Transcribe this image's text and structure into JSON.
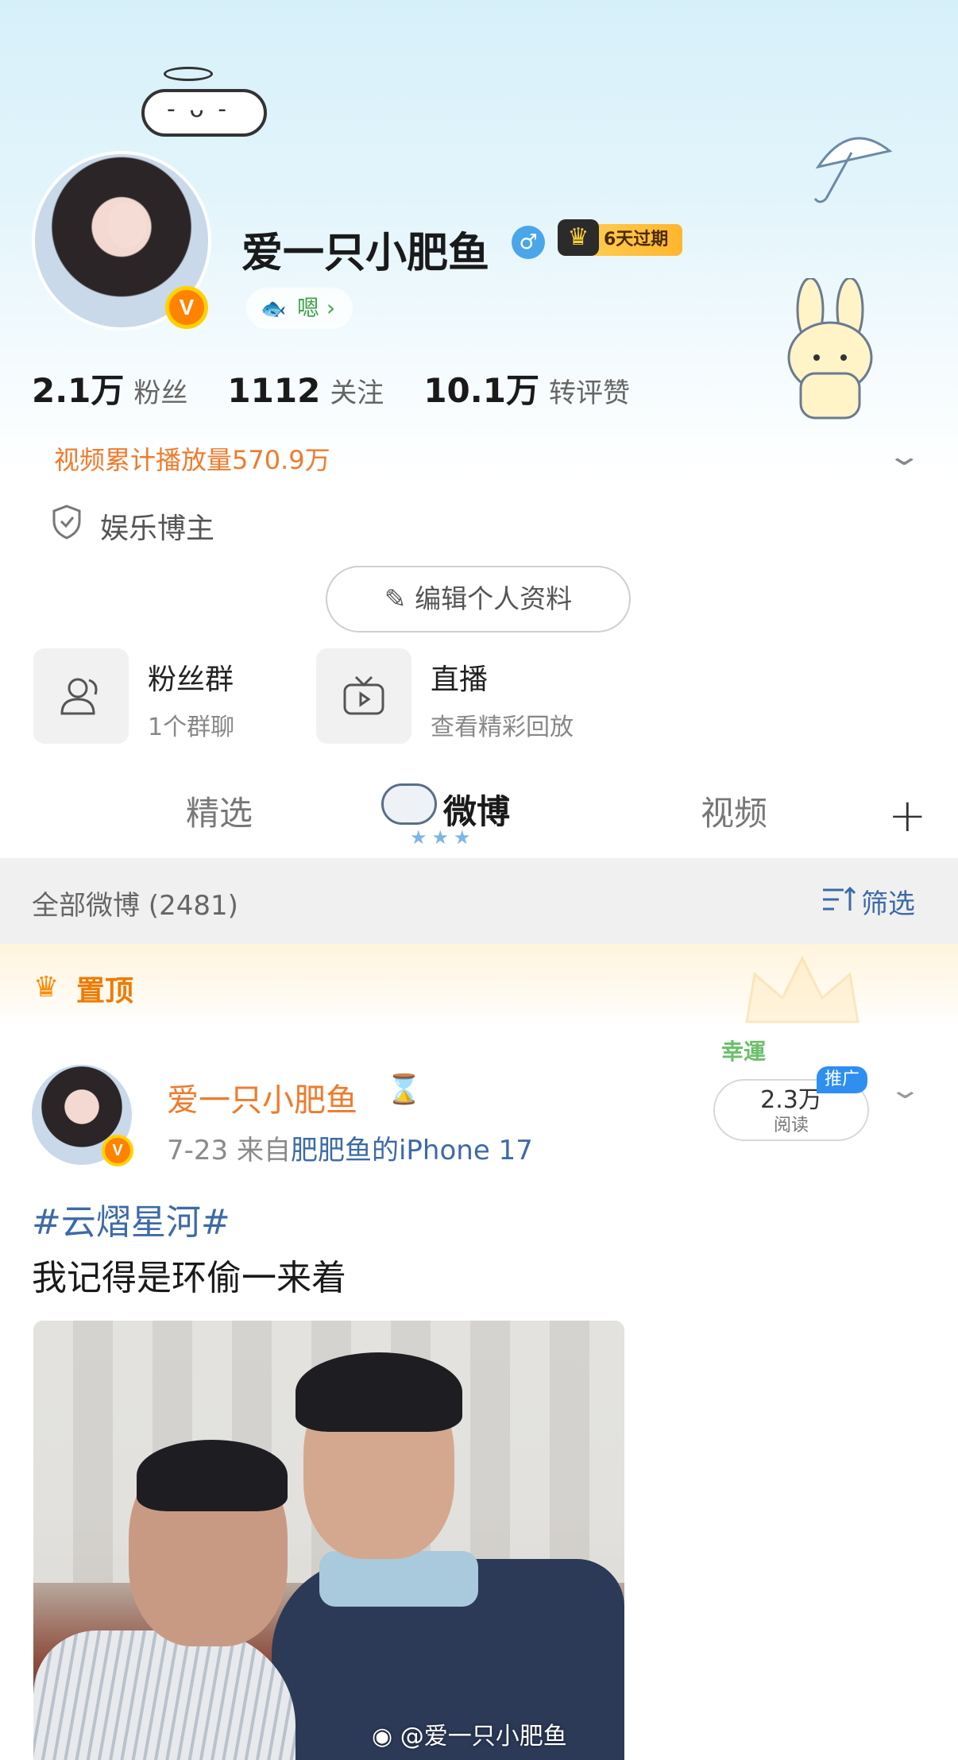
{
  "profile": {
    "name": "爱一只小肥鱼",
    "vip_badge": "6天过期",
    "status_text": "嗯",
    "stats": [
      {
        "value": "2.1万",
        "label": "粉丝"
      },
      {
        "value": "1112",
        "label": "关注"
      },
      {
        "value": "10.1万",
        "label": "转评赞"
      }
    ],
    "video_plays": "视频累计播放量570.9万",
    "category": "娱乐博主",
    "edit_button": "编辑个人资料"
  },
  "tiles": [
    {
      "title": "粉丝群",
      "subtitle": "1个群聊",
      "icon": "group-icon"
    },
    {
      "title": "直播",
      "subtitle": "查看精彩回放",
      "icon": "tv-icon"
    }
  ],
  "tabs": [
    {
      "label": "精选"
    },
    {
      "label": "微博"
    },
    {
      "label": "视频"
    }
  ],
  "filter_bar": {
    "title": "全部微博 (2481)",
    "filter_label": "筛选"
  },
  "pinned": {
    "label": "置顶"
  },
  "post": {
    "username": "爱一只小肥鱼",
    "date": "7-23",
    "source_prefix": "来自",
    "source": "肥肥鱼的iPhone 17",
    "read_count": "2.3万",
    "read_label": "阅读",
    "promo_tag": "推广",
    "lucky_text": "幸運",
    "hashtag": "#云熠星河#",
    "text": "我记得是环偷一来着",
    "watermark": "@爱一只小肥鱼"
  },
  "colors": {
    "accent_orange": "#f07a2c",
    "link_blue": "#3d6aa8",
    "vip_gold": "#ffb62e"
  }
}
